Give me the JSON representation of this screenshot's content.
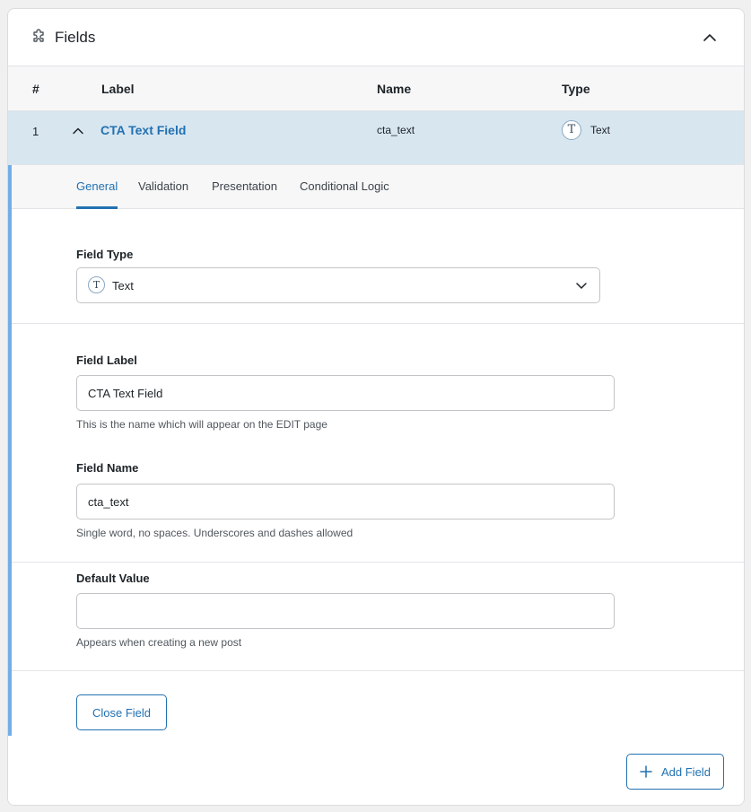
{
  "panel": {
    "title": "Fields",
    "title_icon": "puzzle-icon",
    "collapse_icon": "chevron-up-icon"
  },
  "table": {
    "headers": [
      "#",
      "Label",
      "Name",
      "Type"
    ],
    "rows": [
      {
        "number": "1",
        "label": "CTA Text Field",
        "name": "cta_text",
        "type": "Text",
        "type_icon": "T"
      }
    ]
  },
  "tabs": [
    {
      "label": "General",
      "active": true
    },
    {
      "label": "Validation",
      "active": false
    },
    {
      "label": "Presentation",
      "active": false
    },
    {
      "label": "Conditional Logic",
      "active": false
    }
  ],
  "settings": {
    "field_type": {
      "label": "Field Type",
      "value": "Text",
      "icon": "T"
    },
    "field_label": {
      "label": "Field Label",
      "value": "CTA Text Field",
      "hint": "This is the name which will appear on the EDIT page"
    },
    "field_name": {
      "label": "Field Name",
      "value": "cta_text",
      "hint": "Single word, no spaces. Underscores and dashes allowed"
    },
    "default_value": {
      "label": "Default Value",
      "value": "",
      "hint": "Appears when creating a new post"
    }
  },
  "buttons": {
    "close_field": "Close Field",
    "add_field": "Add Field"
  },
  "colors": {
    "accent": "#2271b1",
    "row_highlight": "#d8e6f0",
    "left_bar": "#72aee6"
  }
}
